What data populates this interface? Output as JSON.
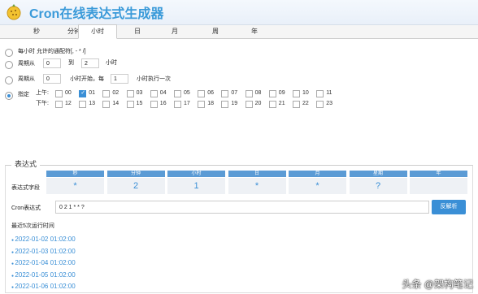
{
  "header": {
    "title": "Cron在线表达式生成器"
  },
  "tabs": [
    "秒",
    "分钟",
    "小时",
    "日",
    "月",
    "周",
    "年"
  ],
  "hour_options": {
    "every": "每小时 允许的通配符[, - * /]",
    "period_from": "周期从",
    "period_from_value": "0",
    "period_to": "到",
    "period_to_value": "2",
    "period_unit": "小时",
    "cycle_from": "周期从",
    "cycle_from_value": "0",
    "cycle_mid": "小时开始，每",
    "cycle_every_value": "1",
    "cycle_tail": "小时执行一次",
    "assign": "指定",
    "am": "上午:",
    "pm": "下午:",
    "hours_am": [
      "00",
      "01",
      "02",
      "03",
      "04",
      "05",
      "06",
      "07",
      "08",
      "09",
      "10",
      "11"
    ],
    "hours_pm": [
      "12",
      "13",
      "14",
      "15",
      "16",
      "17",
      "18",
      "19",
      "20",
      "21",
      "22",
      "23"
    ],
    "checked": "01"
  },
  "expression": {
    "legend": "表达式",
    "field_label": "表达式字段",
    "columns": [
      "秒",
      "分钟",
      "小时",
      "日",
      "月",
      "星期",
      "年"
    ],
    "values": [
      "*",
      "2",
      "1",
      "*",
      "*",
      "?",
      ""
    ],
    "cron_label": "Cron表达式",
    "cron_value": "0 2 1 * * ?",
    "parse_button": "反解析",
    "recent_label": "最近5次运行时间",
    "runs": [
      "2022-01-02 01:02:00",
      "2022-01-03 01:02:00",
      "2022-01-04 01:02:00",
      "2022-01-05 01:02:00",
      "2022-01-06 01:02:00"
    ]
  },
  "watermark": "头条 @架构笔记"
}
